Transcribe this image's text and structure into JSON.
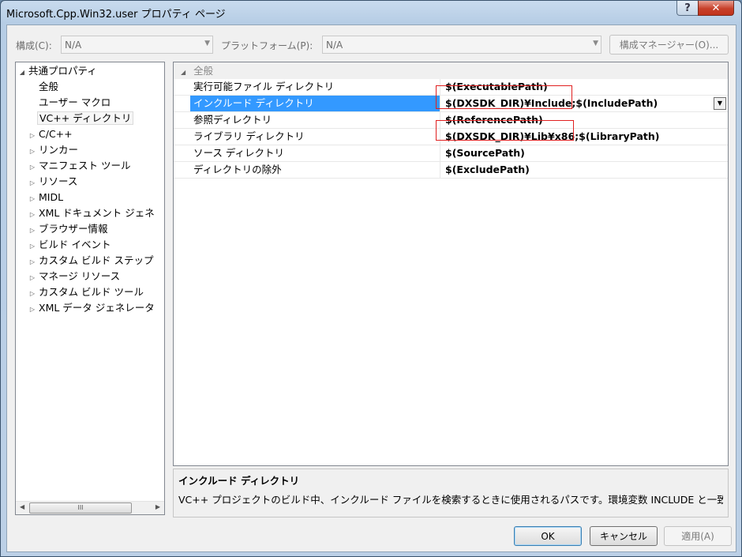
{
  "window": {
    "title": "Microsoft.Cpp.Win32.user プロパティ ページ"
  },
  "titlebar": {
    "help": "?",
    "close": "✕"
  },
  "toolbar": {
    "config_label": "構成(C):",
    "config_value": "N/A",
    "platform_label": "プラットフォーム(P):",
    "platform_value": "N/A",
    "config_manager": "構成マネージャー(O)..."
  },
  "tree": {
    "root": "共通プロパティ",
    "items": [
      {
        "label": "全般"
      },
      {
        "label": "ユーザー マクロ"
      },
      {
        "label": "VC++ ディレクトリ",
        "selected": true
      },
      {
        "label": "C/C++"
      },
      {
        "label": "リンカー"
      },
      {
        "label": "マニフェスト ツール"
      },
      {
        "label": "リソース"
      },
      {
        "label": "MIDL"
      },
      {
        "label": "XML ドキュメント ジェネ"
      },
      {
        "label": "ブラウザー情報"
      },
      {
        "label": "ビルド イベント"
      },
      {
        "label": "カスタム ビルド ステップ"
      },
      {
        "label": "マネージ リソース"
      },
      {
        "label": "カスタム ビルド ツール"
      },
      {
        "label": "XML データ ジェネレータ"
      }
    ],
    "scroll_thumb": "III"
  },
  "grid": {
    "category": "全般",
    "rows": [
      {
        "name": "実行可能ファイル ディレクトリ",
        "value": "$(ExecutablePath)"
      },
      {
        "name": "インクルード ディレクトリ",
        "value": "$(DXSDK_DIR)¥Include;$(IncludePath)",
        "selected": true
      },
      {
        "name": "参照ディレクトリ",
        "value": "$(ReferencePath)"
      },
      {
        "name": "ライブラリ ディレクトリ",
        "value": "$(DXSDK_DIR)¥Lib¥x86;$(LibraryPath)"
      },
      {
        "name": "ソース ディレクトリ",
        "value": "$(SourcePath)"
      },
      {
        "name": "ディレクトリの除外",
        "value": "$(ExcludePath)"
      }
    ]
  },
  "description": {
    "title": "インクルード ディレクトリ",
    "text": "VC++ プロジェクトのビルド中、インクルード ファイルを検索するときに使用されるパスです。環境変数 INCLUDE と一致..."
  },
  "buttons": {
    "ok": "OK",
    "cancel": "キャンセル",
    "apply": "適用(A)"
  },
  "colors": {
    "selection": "#3399ff",
    "highlight_box": "#e02020"
  }
}
